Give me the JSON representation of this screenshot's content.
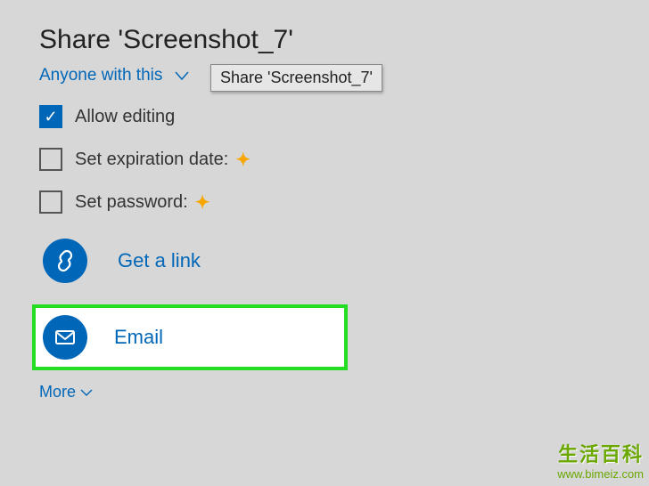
{
  "title": "Share 'Screenshot_7'",
  "permission": {
    "label": "Anyone with this",
    "tooltip": "Share 'Screenshot_7'"
  },
  "options": {
    "allow_editing": {
      "label": "Allow editing",
      "checked": true
    },
    "expiration": {
      "label": "Set expiration date:",
      "checked": false
    },
    "password": {
      "label": "Set password:",
      "checked": false
    }
  },
  "actions": {
    "get_link": "Get a link",
    "email": "Email"
  },
  "more": "More",
  "watermark": {
    "title": "生活百科",
    "url": "www.bimeiz.com"
  },
  "colors": {
    "accent": "#0067b8",
    "highlight_border": "#22dd22",
    "plus": "#f7a700"
  }
}
